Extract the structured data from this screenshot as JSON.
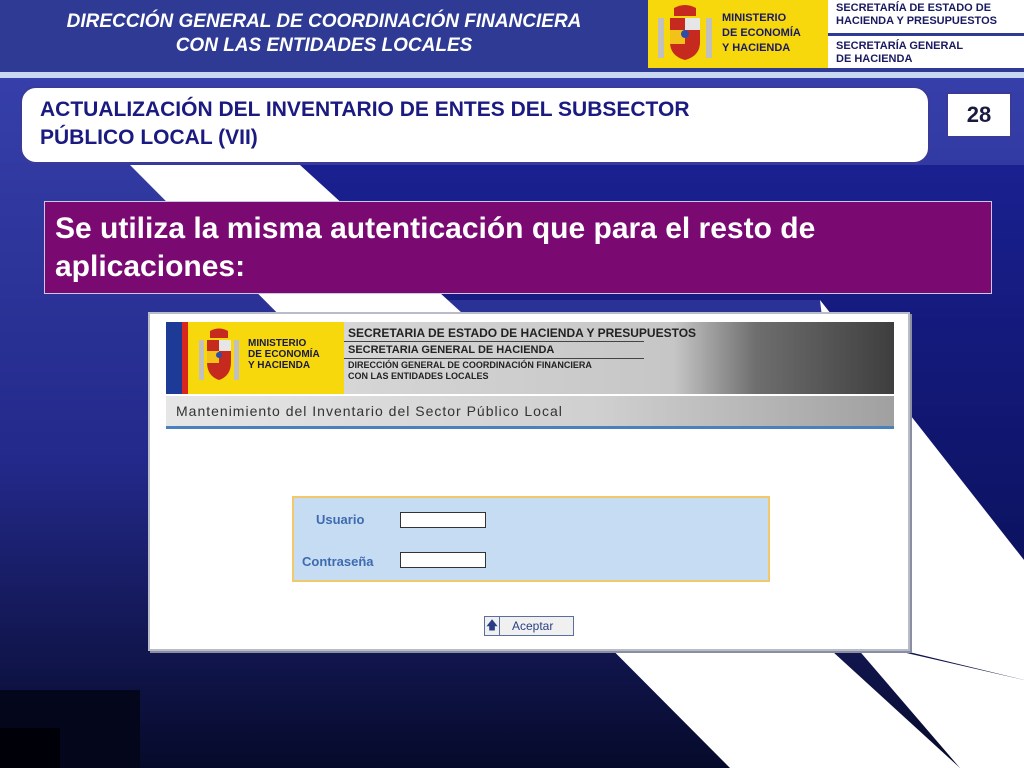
{
  "header": {
    "title_line1": "DIRECCIÓN GENERAL DE COORDINACIÓN FINANCIERA",
    "title_line2": "CON LAS ENTIDADES LOCALES",
    "ministry": [
      "MINISTERIO",
      "DE ECONOMÍA",
      "Y HACIENDA"
    ],
    "secretariat1": [
      "SECRETARÍA DE ESTADO DE",
      "HACIENDA Y PRESUPUESTOS"
    ],
    "secretariat2": [
      "SECRETARÍA GENERAL",
      "DE HACIENDA"
    ]
  },
  "slide": {
    "title_line1": "ACTUALIZACIÓN DEL INVENTARIO DE ENTES DEL SUBSECTOR",
    "title_line2": "PÚBLICO LOCAL (VII)",
    "page_number": "28",
    "banner_line1": "Se utiliza la misma autenticación que para el resto de",
    "banner_line2": "aplicaciones:"
  },
  "app": {
    "ministry": [
      "MINISTERIO",
      "DE ECONOMÍA",
      "Y HACIENDA"
    ],
    "sec_line1": "SECRETARIA DE ESTADO DE HACIENDA Y PRESUPUESTOS",
    "sec_line2": "SECRETARIA GENERAL DE HACIENDA",
    "sec_line3a": "DIRECCIÓN GENERAL DE COORDINACIÓN FINANCIERA",
    "sec_line3b": "CON LAS ENTIDADES LOCALES",
    "band_title": "Mantenimiento del Inventario del Sector Público Local",
    "login": {
      "user_label": "Usuario",
      "user_value": "",
      "password_label": "Contraseña",
      "password_value": ""
    },
    "accept_label": "Aceptar"
  },
  "colors": {
    "navy": "#2e3a94",
    "yellow": "#f6d80c",
    "purple": "#7a0a72",
    "title_text": "#1a1a80"
  }
}
